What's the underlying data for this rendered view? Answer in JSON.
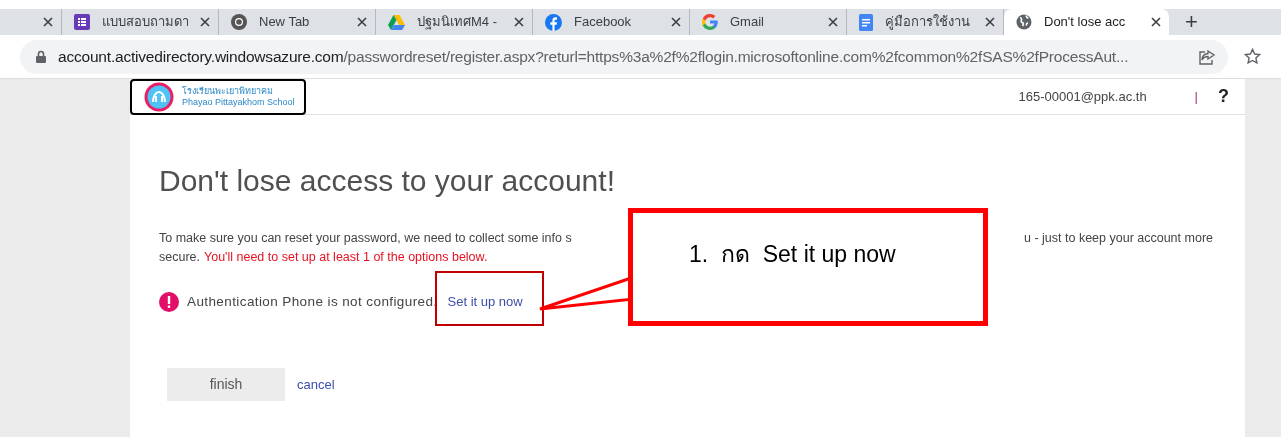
{
  "browser": {
    "tabs": [
      {
        "selected": false
      },
      {
        "title": "แบบสอบถามดา",
        "selected": false
      },
      {
        "title": "New Tab",
        "selected": false
      },
      {
        "title": "ปฐมนิเทศM4 -",
        "selected": false
      },
      {
        "title": "Facebook",
        "selected": false
      },
      {
        "title": "Gmail",
        "selected": false
      },
      {
        "title": "คู่มือการใช้งาน",
        "selected": false
      },
      {
        "title": "Don't lose acc",
        "selected": true
      }
    ],
    "new_tab": "+",
    "url_host": "account.activedirectory.windowsazure.com",
    "url_path": "/passwordreset/register.aspx?returl=https%3a%2f%2flogin.microsoftonline.com%2fcommon%2fSAS%2fProcessAut..."
  },
  "header": {
    "logo_title": "โรงเรียนพะเยาพิทยาคม",
    "logo_subtitle": "Phayao Pittayakhom School",
    "user": "165-00001@ppk.ac.th",
    "separator": "|",
    "help": "?"
  },
  "content": {
    "heading": "Don't lose access to your account!",
    "intro_left": "To make sure you can reset your password, we need to collect some info s",
    "intro_right": "u - just to keep your account more",
    "intro_line2": "secure.",
    "warning": "You'll need to set up at least 1 of the options below.",
    "status": {
      "text": "Authentication Phone is not configured.",
      "link": "Set it up now"
    },
    "finish": "finish",
    "cancel": "cancel"
  },
  "callout": {
    "text": "1.  กด  Set it up now"
  }
}
